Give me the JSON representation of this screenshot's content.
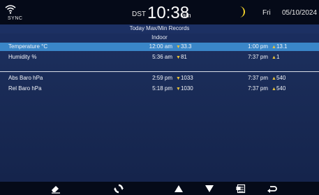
{
  "status": {
    "sync_label": "SYNC",
    "dst_label": "DST",
    "time": "10:38",
    "ampm": "am",
    "weekday": "Fri",
    "date": "05/10/2024"
  },
  "title": "Today Max/Min Records",
  "section": "Indoor",
  "rows": [
    {
      "label": "Temperature °C",
      "time1": "12:00 am",
      "value1": "33.3",
      "time2": "1:00 pm",
      "value2": "13.1"
    },
    {
      "label": "Humidity %",
      "time1": "5:36 am",
      "value1": "81",
      "time2": "7:37 pm",
      "value2": "1"
    },
    {
      "label": "Abs Baro hPa",
      "time1": "2:59 pm",
      "value1": "1033",
      "time2": "7:37 pm",
      "value2": "540"
    },
    {
      "label": "Rel Baro hPa",
      "time1": "5:18 pm",
      "value1": "1030",
      "time2": "7:37 pm",
      "value2": "540"
    }
  ],
  "markers": {
    "max": "▼",
    "min": "▲"
  },
  "icons": {
    "wifi": "wifi-icon",
    "moon": "moon-icon",
    "erase": "eraser-icon",
    "refresh": "refresh-icon",
    "up": "arrow-up-icon",
    "down": "arrow-down-icon",
    "export": "export-icon",
    "back": "back-icon"
  },
  "colors": {
    "statusbar": "#050a18",
    "screen": "#1f3466",
    "selected_row": "#3a86c8",
    "marker": "#e8c23a",
    "moon": "#f2d22a"
  }
}
